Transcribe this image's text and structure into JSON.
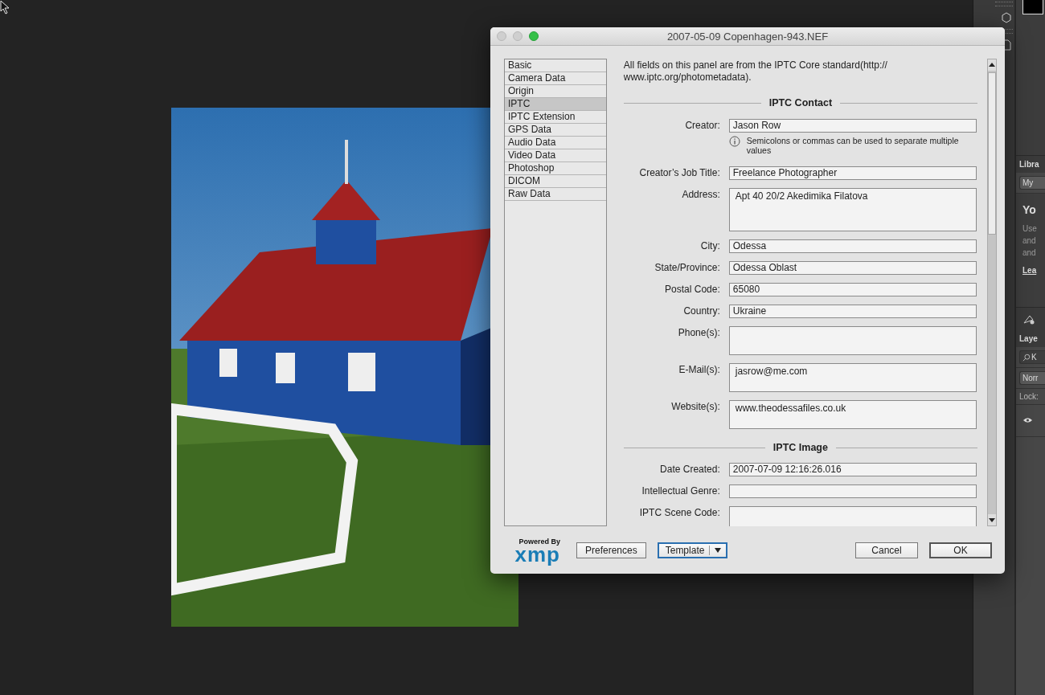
{
  "dialog": {
    "title": "2007-05-09 Copenhagen-943.NEF",
    "categories": [
      {
        "label": "Basic",
        "selected": false
      },
      {
        "label": "Camera Data",
        "selected": false
      },
      {
        "label": "Origin",
        "selected": false
      },
      {
        "label": "IPTC",
        "selected": true
      },
      {
        "label": "IPTC Extension",
        "selected": false
      },
      {
        "label": "GPS Data",
        "selected": false
      },
      {
        "label": "Audio Data",
        "selected": false
      },
      {
        "label": "Video Data",
        "selected": false
      },
      {
        "label": "Photoshop",
        "selected": false
      },
      {
        "label": "DICOM",
        "selected": false
      },
      {
        "label": "Raw Data",
        "selected": false
      }
    ],
    "intro": "All fields on this panel are from the IPTC Core standard(http:// www.iptc.org/photometadata).",
    "sections": [
      {
        "title": "IPTC Contact",
        "fields": [
          {
            "label": "Creator:",
            "value": "Jason Row",
            "kind": "line",
            "note": "Semicolons or commas can be used to separate multiple values"
          },
          {
            "label": "Creator’s Job Title:",
            "value": "Freelance Photographer",
            "kind": "line"
          },
          {
            "label": "Address:",
            "value": "Apt 40 20/2 Akedimika Filatova",
            "kind": "tall"
          },
          {
            "label": "City:",
            "value": "Odessa",
            "kind": "line"
          },
          {
            "label": "State/Province:",
            "value": "Odessa Oblast",
            "kind": "line"
          },
          {
            "label": "Postal Code:",
            "value": "65080",
            "kind": "line"
          },
          {
            "label": "Country:",
            "value": "Ukraine",
            "kind": "line"
          },
          {
            "label": "Phone(s):",
            "kind": "box"
          },
          {
            "label": "E-Mail(s):",
            "value": "jasrow@me.com",
            "kind": "box"
          },
          {
            "label": "Website(s):",
            "value": "www.theodessafiles.co.uk",
            "kind": "box"
          }
        ]
      },
      {
        "title": "IPTC Image",
        "fields": [
          {
            "label": "Date Created:",
            "value": "2007-07-09 12:16:26.016",
            "kind": "line"
          },
          {
            "label": "Intellectual Genre:",
            "kind": "line"
          },
          {
            "label": "IPTC Scene Code:",
            "kind": "box"
          }
        ]
      }
    ],
    "logo": {
      "tagline": "Powered By",
      "name": "xmp"
    },
    "buttons": [
      {
        "label": "Preferences",
        "kind": "plain"
      },
      {
        "label": "Template",
        "kind": "menu"
      }
    ],
    "actions": [
      {
        "label": "Cancel"
      },
      {
        "label": "OK"
      }
    ]
  },
  "right_panel": {
    "libraries_tab": "Libra",
    "library_button": "My",
    "heading": "Yo",
    "lines": [
      "Use",
      "and",
      "and"
    ],
    "link": "Lea",
    "layers_tab": "Laye",
    "filter": "K",
    "blend_mode": "Norr",
    "lock_label": "Lock:"
  }
}
